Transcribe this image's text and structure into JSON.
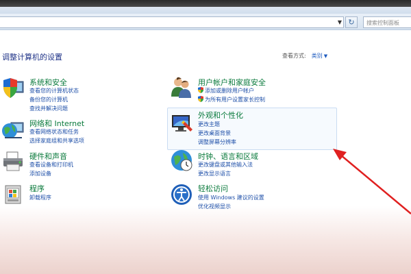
{
  "search": {
    "placeholder": "搜索控制面板"
  },
  "main": {
    "title": "调整计算机的设置",
    "view_by_label": "查看方式:",
    "view_by_value": "类别"
  },
  "categories": [
    {
      "title": "系统和安全",
      "links": [
        "查看您的计算机状态",
        "备份您的计算机",
        "查找并解决问题"
      ]
    },
    {
      "title": "网络和 Internet",
      "links": [
        "查看网络状态和任务",
        "选择家庭组和共享选项"
      ]
    },
    {
      "title": "硬件和声音",
      "links": [
        "查看设备和打印机",
        "添加设备"
      ]
    },
    {
      "title": "程序",
      "links": [
        "卸载程序"
      ]
    },
    {
      "title": "用户帐户和家庭安全",
      "links": [
        "添加或删除用户帐户",
        "为所有用户设置家长控制"
      ]
    },
    {
      "title": "外观和个性化",
      "links": [
        "更改主题",
        "更改桌面背景",
        "调整屏幕分辨率"
      ]
    },
    {
      "title": "时钟、语言和区域",
      "links": [
        "更改键盘或其他输入法",
        "更改显示语言"
      ]
    },
    {
      "title": "轻松访问",
      "links": [
        "使用 Windows 建议的设置",
        "优化视频显示"
      ]
    }
  ],
  "colors": {
    "category_title": "#0a7a3c",
    "link": "#1e4fa8",
    "title": "#1e3287",
    "annotation_arrow": "#e02020"
  },
  "icons": {
    "system_security": "shield-computer-icon",
    "network": "globe-network-icon",
    "hardware": "printer-icon",
    "programs": "programs-box-icon",
    "users": "users-icon",
    "appearance": "display-color-icon",
    "clock": "globe-clock-icon",
    "ease": "ease-of-access-icon"
  }
}
